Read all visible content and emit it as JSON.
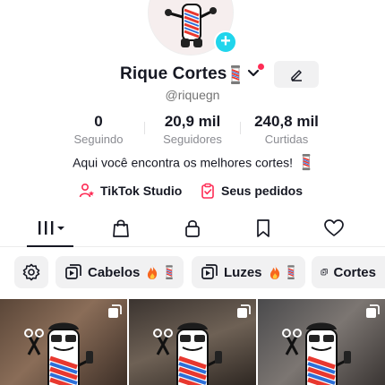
{
  "profile": {
    "name": "Rique Cortes",
    "name_emoji": "💈",
    "handle": "@riquegn",
    "bio_text": "Aqui você encontra os melhores cortes!",
    "bio_emoji": "💈"
  },
  "stats": {
    "following": {
      "value": "0",
      "label": "Seguindo"
    },
    "followers": {
      "value": "20,9 mil",
      "label": "Seguidores"
    },
    "likes": {
      "value": "240,8 mil",
      "label": "Curtidas"
    }
  },
  "links": {
    "studio": "TikTok Studio",
    "orders": "Seus pedidos"
  },
  "tabs": [
    {
      "name": "videos",
      "icon": "grid-icon",
      "active": true
    },
    {
      "name": "shop",
      "icon": "bag-icon"
    },
    {
      "name": "private",
      "icon": "lock-icon"
    },
    {
      "name": "saved",
      "icon": "bookmark-icon"
    },
    {
      "name": "liked",
      "icon": "heart-icon"
    }
  ],
  "playlists": [
    {
      "label": "Cabelos",
      "emoji": "🔥💈"
    },
    {
      "label": "Luzes",
      "emoji": "🔥💈"
    },
    {
      "label": "Cortes",
      "emoji": ""
    }
  ],
  "colors": {
    "accent_cyan": "#20d5ec",
    "notification_red": "#fe2c55",
    "studio_icon": "#fe2c55",
    "orders_icon": "#fe2c55",
    "pole_red": "#e8382f",
    "pole_blue": "#2d6fd8"
  }
}
